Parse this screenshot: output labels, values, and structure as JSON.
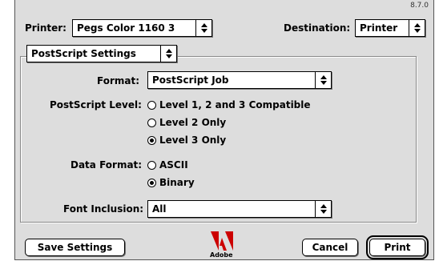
{
  "version": "8.7.0",
  "printer": {
    "label": "Printer:",
    "value": "Pegs Color 1160 3"
  },
  "destination": {
    "label": "Destination:",
    "value": "Printer"
  },
  "panel": {
    "value": "PostScript Settings"
  },
  "format": {
    "label": "Format:",
    "value": "PostScript Job"
  },
  "postscript_level": {
    "label": "PostScript Level:",
    "options": [
      {
        "label": "Level 1, 2 and 3 Compatible",
        "selected": false
      },
      {
        "label": "Level 2 Only",
        "selected": false
      },
      {
        "label": "Level 3 Only",
        "selected": true
      }
    ]
  },
  "data_format": {
    "label": "Data Format:",
    "options": [
      {
        "label": "ASCII",
        "selected": false
      },
      {
        "label": "Binary",
        "selected": true
      }
    ]
  },
  "font_inclusion": {
    "label": "Font Inclusion:",
    "value": "All"
  },
  "buttons": {
    "save": "Save Settings",
    "cancel": "Cancel",
    "print": "Print"
  },
  "logo": {
    "text": "Adobe",
    "color": "#cc0000"
  }
}
